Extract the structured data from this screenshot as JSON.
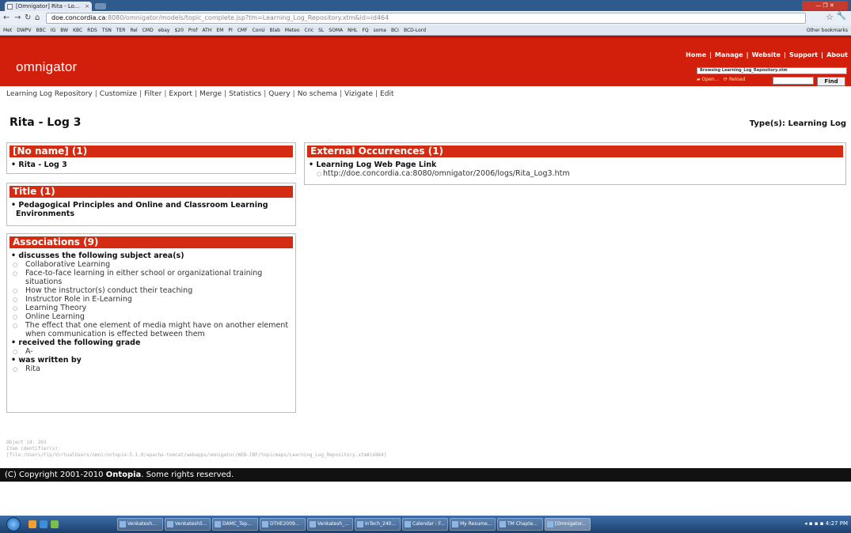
{
  "browser": {
    "tab_title": "[Omnigator] Rita - Lo...",
    "url_host": "doe.concordia.ca",
    "url_rest": ":8080/omnigator/models/topic_complete.jsp?tm=Learning_Log_Repository.xtm&id=id464",
    "bookmarks": [
      "Met",
      "DWPV",
      "BBC",
      "IG",
      "BW",
      "KBC",
      "RDS",
      "TSN",
      "TER",
      "Rel",
      "CMD",
      "ebay",
      "$20",
      "Prof",
      "ATH",
      "EM",
      "PI",
      "CMF",
      "ConU",
      "Blab",
      "Meteo",
      "Cric",
      "SL",
      "SOMA",
      "NHL",
      "FQ",
      "soma",
      "BCI",
      "BCD-Lord"
    ],
    "other_bookmarks": "Other bookmarks"
  },
  "omnigator": {
    "logo": "omnigator",
    "menu": [
      "Home",
      "Manage",
      "Website",
      "Support",
      "About"
    ],
    "browsing": "Browsing Learning_Log_Repository.xtm",
    "open": "Open...",
    "reload": "Reload",
    "find": "Find"
  },
  "pagemenu": [
    "Learning Log Repository",
    "Customize",
    "Filter",
    "Export",
    "Merge",
    "Statistics",
    "Query",
    "No schema",
    "Vizigate",
    "Edit"
  ],
  "topic": {
    "title": "Rita - Log 3",
    "types": "Type(s): Learning Log"
  },
  "noname_box": {
    "header": "[No name] (1)",
    "item": "Rita - Log 3"
  },
  "title_box": {
    "header": "Title (1)",
    "item": "Pedagogical Principles and Online and Classroom Learning Environments"
  },
  "assoc_box": {
    "header": "Associations (9)",
    "groups": [
      {
        "label": "discusses the following subject area(s)",
        "items": [
          "Collaborative Learning",
          "Face-to-face learning in either school or organizational training situations",
          "How the instructor(s) conduct their teaching",
          "Instructor Role in E-Learning",
          "Learning Theory",
          "Online Learning",
          "The effect that one element of media might have on another element when communication is effected between them"
        ]
      },
      {
        "label": "received the following grade",
        "items": [
          "A-"
        ]
      },
      {
        "label": "was written by",
        "items": [
          "Rita"
        ]
      }
    ]
  },
  "occ_box": {
    "header": "External Occurrences (1)",
    "type": "Learning Log Web Page Link",
    "url": "http://doe.concordia.ca:8080/omnigator/2006/logs/Rita_Log3.htm"
  },
  "meta": {
    "line1": "Object id: 263",
    "line2": "Item identifier(s):",
    "line3": "[file:/Users/Fip/VirtualUsers/omni/ontopia-5.1.0/apache-tomcat/webapps/omnigator/WEB-INF/topicmaps/Learning_Log_Repository.xtm#id464]"
  },
  "footer": {
    "prefix": "(C) Copyright 2001-2010",
    "brand": "Ontopia",
    "suffix": ". Some rights reserved."
  },
  "taskbar": {
    "tasks": [
      "Venkatesh...",
      "Venkatesh5...",
      "DAMC_Top...",
      "DTHE2009...",
      "Venkatesh_...",
      "InTech_240...",
      "Calendar : F...",
      "My Resume...",
      "TM Chapte...",
      "[Omnigator..."
    ],
    "clock": "4:27 PM"
  },
  "colors": {
    "header_red": "#d11f0c",
    "box_head_red": "#d52b12",
    "footer_black": "#111111"
  }
}
